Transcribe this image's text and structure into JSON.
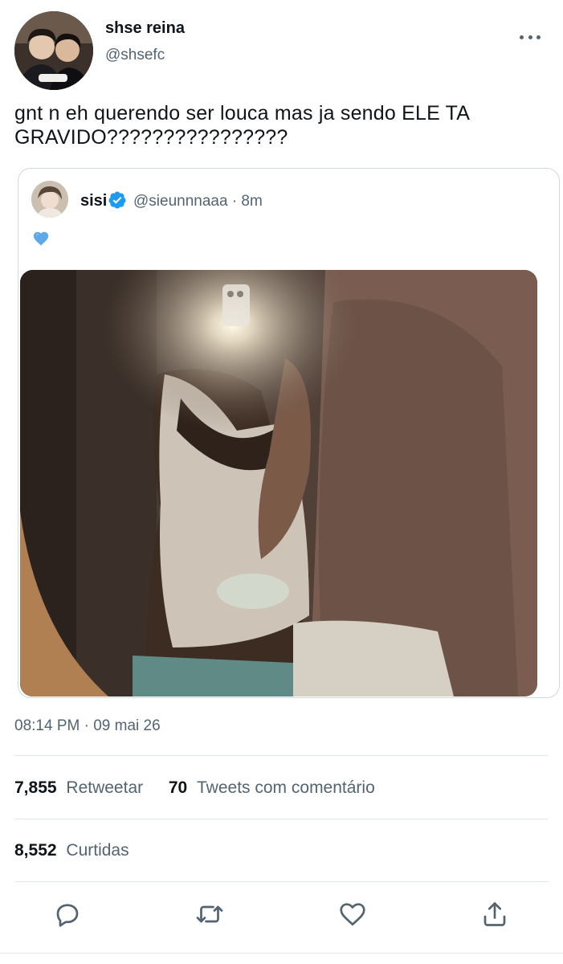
{
  "author": {
    "name": "shse reina",
    "handle": "@shsefc"
  },
  "tweet": {
    "text": "gnt n eh querendo ser louca mas ja sendo ELE TA GRAVIDO????????????????"
  },
  "quoted": {
    "name": "sisi",
    "handle_time": "@sieunnnaaa · 8m",
    "text_emoji": "blue-heart"
  },
  "timestamp": "08:14 PM · 09 mai 26",
  "stats": {
    "retweets_count": "7,855",
    "retweets_label": "Retweetar",
    "quotes_count": "70",
    "quotes_label": "Tweets com comentário",
    "likes_count": "8,552",
    "likes_label": "Curtidas"
  },
  "icons": {
    "more": "more-icon",
    "verified": "verified-badge-icon",
    "reply": "reply-icon",
    "retweet": "retweet-icon",
    "like": "heart-icon",
    "share": "share-icon"
  },
  "colors": {
    "verified_blue": "#1d9bf0",
    "secondary_text": "#536471",
    "primary_text": "#0f1419"
  }
}
